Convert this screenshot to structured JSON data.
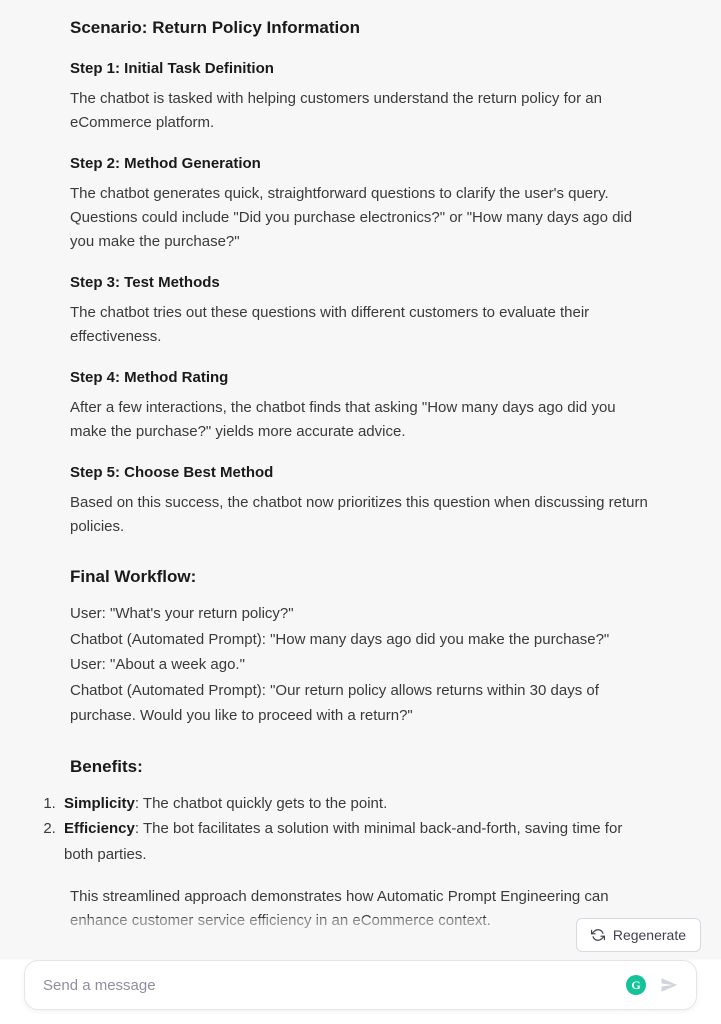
{
  "scenario": {
    "title": "Scenario: Return Policy Information",
    "steps": [
      {
        "heading": "Step 1: Initial Task Definition",
        "body": "The chatbot is tasked with helping customers understand the return policy for an eCommerce platform."
      },
      {
        "heading": "Step 2: Method Generation",
        "body": "The chatbot generates quick, straightforward questions to clarify the user's query. Questions could include \"Did you purchase electronics?\" or \"How many days ago did you make the purchase?\""
      },
      {
        "heading": "Step 3: Test Methods",
        "body": "The chatbot tries out these questions with different customers to evaluate their effectiveness."
      },
      {
        "heading": "Step 4: Method Rating",
        "body": "After a few interactions, the chatbot finds that asking \"How many days ago did you make the purchase?\" yields more accurate advice."
      },
      {
        "heading": "Step 5: Choose Best Method",
        "body": "Based on this success, the chatbot now prioritizes this question when discussing return policies."
      }
    ]
  },
  "workflow": {
    "heading": "Final Workflow:",
    "lines": [
      "User: \"What's your return policy?\"",
      "Chatbot (Automated Prompt): \"How many days ago did you make the purchase?\"",
      "User: \"About a week ago.\"",
      "Chatbot (Automated Prompt): \"Our return policy allows returns within 30 days of purchase. Would you like to proceed with a return?\""
    ]
  },
  "benefits": {
    "heading": "Benefits:",
    "items": [
      {
        "bold": "Simplicity",
        "rest": ": The chatbot quickly gets to the point."
      },
      {
        "bold": "Efficiency",
        "rest": ": The bot facilitates a solution with minimal back-and-forth, saving time for both parties."
      }
    ],
    "closing": "This streamlined approach demonstrates how Automatic Prompt Engineering can enhance customer service efficiency in an eCommerce context."
  },
  "footer": {
    "regenerate_label": "Regenerate",
    "input_placeholder": "Send a message",
    "grammarly_glyph": "G"
  }
}
